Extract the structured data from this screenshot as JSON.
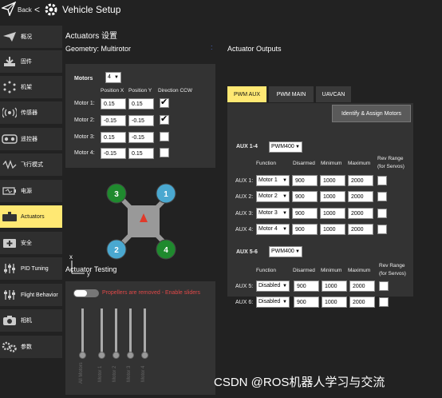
{
  "header": {
    "back_label": "Back",
    "back_arrow": "<",
    "title": "Vehicle Setup"
  },
  "sidebar": {
    "items": [
      {
        "label": "概况",
        "icon": "plane-icon",
        "active": false
      },
      {
        "label": "固件",
        "icon": "download-icon",
        "active": false
      },
      {
        "label": "机架",
        "icon": "frame-icon",
        "active": false
      },
      {
        "label": "传感器",
        "icon": "sensor-icon",
        "active": false
      },
      {
        "label": "遥控器",
        "icon": "rc-icon",
        "active": false
      },
      {
        "label": "飞行模式",
        "icon": "wave-icon",
        "active": false
      },
      {
        "label": "电源",
        "icon": "battery-icon",
        "active": false
      },
      {
        "label": "Actuators",
        "icon": "actuator-icon",
        "active": true
      },
      {
        "label": "安全",
        "icon": "first-aid-icon",
        "active": false
      },
      {
        "label": "PID Tuning",
        "icon": "tuning-icon",
        "active": false
      },
      {
        "label": "Flight Behavior",
        "icon": "flight-behavior-icon",
        "active": false
      },
      {
        "label": "相机",
        "icon": "camera-icon",
        "active": false
      },
      {
        "label": "参数",
        "icon": "parameters-icon",
        "active": false
      }
    ]
  },
  "actuators": {
    "heading": "Actuators 设置",
    "geometry_label": "Geometry: Multirotor",
    "motors_label": "Motors",
    "motors_count": "4",
    "col_pos_x": "Position X",
    "col_pos_y": "Position Y",
    "col_dir": "Direction CCW",
    "motors": [
      {
        "label": "Motor 1:",
        "x": "0.15",
        "y": "0.15",
        "ccw": true
      },
      {
        "label": "Motor 2:",
        "x": "-0.15",
        "y": "-0.15",
        "ccw": true
      },
      {
        "label": "Motor 3:",
        "x": "0.15",
        "y": "-0.15",
        "ccw": false
      },
      {
        "label": "Motor 4:",
        "x": "-0.15",
        "y": "0.15",
        "ccw": false
      }
    ],
    "diagram": {
      "rotors": [
        "3",
        "1",
        "2",
        "4"
      ],
      "axis_x": "x",
      "axis_y": "y"
    },
    "testing_heading": "Actuator Testing",
    "warning": "Propellers are removed - Enable sliders",
    "sliders": [
      "All Motors",
      "Motor 1",
      "Motor 2",
      "Motor 3",
      "Motor 4"
    ]
  },
  "outputs": {
    "heading": "Actuator Outputs",
    "tabs": [
      "PWM AUX",
      "PWM MAIN",
      "UAVCAN"
    ],
    "identify_button": "Identify & Assign Motors",
    "group1": {
      "title": "AUX 1-4",
      "protocol": "PWM400",
      "col_function": "Function",
      "col_disarmed": "Disarmed",
      "col_minimum": "Minimum",
      "col_maximum": "Maximum",
      "col_rev": "Rev Range",
      "col_rev2": "(for Servos)",
      "rows": [
        {
          "label": "AUX 1:",
          "function": "Motor 1",
          "disarmed": "900",
          "min": "1000",
          "max": "2000"
        },
        {
          "label": "AUX 2:",
          "function": "Motor 2",
          "disarmed": "900",
          "min": "1000",
          "max": "2000"
        },
        {
          "label": "AUX 3:",
          "function": "Motor 3",
          "disarmed": "900",
          "min": "1000",
          "max": "2000"
        },
        {
          "label": "AUX 4:",
          "function": "Motor 4",
          "disarmed": "900",
          "min": "1000",
          "max": "2000"
        }
      ]
    },
    "group2": {
      "title": "AUX 5-6",
      "protocol": "PWM400",
      "col_function": "Function",
      "col_disarmed": "Disarmed",
      "col_minimum": "Minimum",
      "col_maximum": "Maximum",
      "col_rev": "Rev Range",
      "col_rev2": "(for Servos)",
      "rows": [
        {
          "label": "AUX 5:",
          "function": "Disabled",
          "disarmed": "900",
          "min": "1000",
          "max": "2000"
        },
        {
          "label": "AUX 6:",
          "function": "Disabled",
          "disarmed": "900",
          "min": "1000",
          "max": "2000"
        }
      ]
    }
  },
  "watermark": "CSDN @ROS机器人学习与交流",
  "colors": {
    "accent": "#ffe873",
    "panel": "#333333",
    "warning": "#e04848",
    "rotor_ccw": "#1f8a2e",
    "rotor_cw": "#4aa8d0"
  }
}
